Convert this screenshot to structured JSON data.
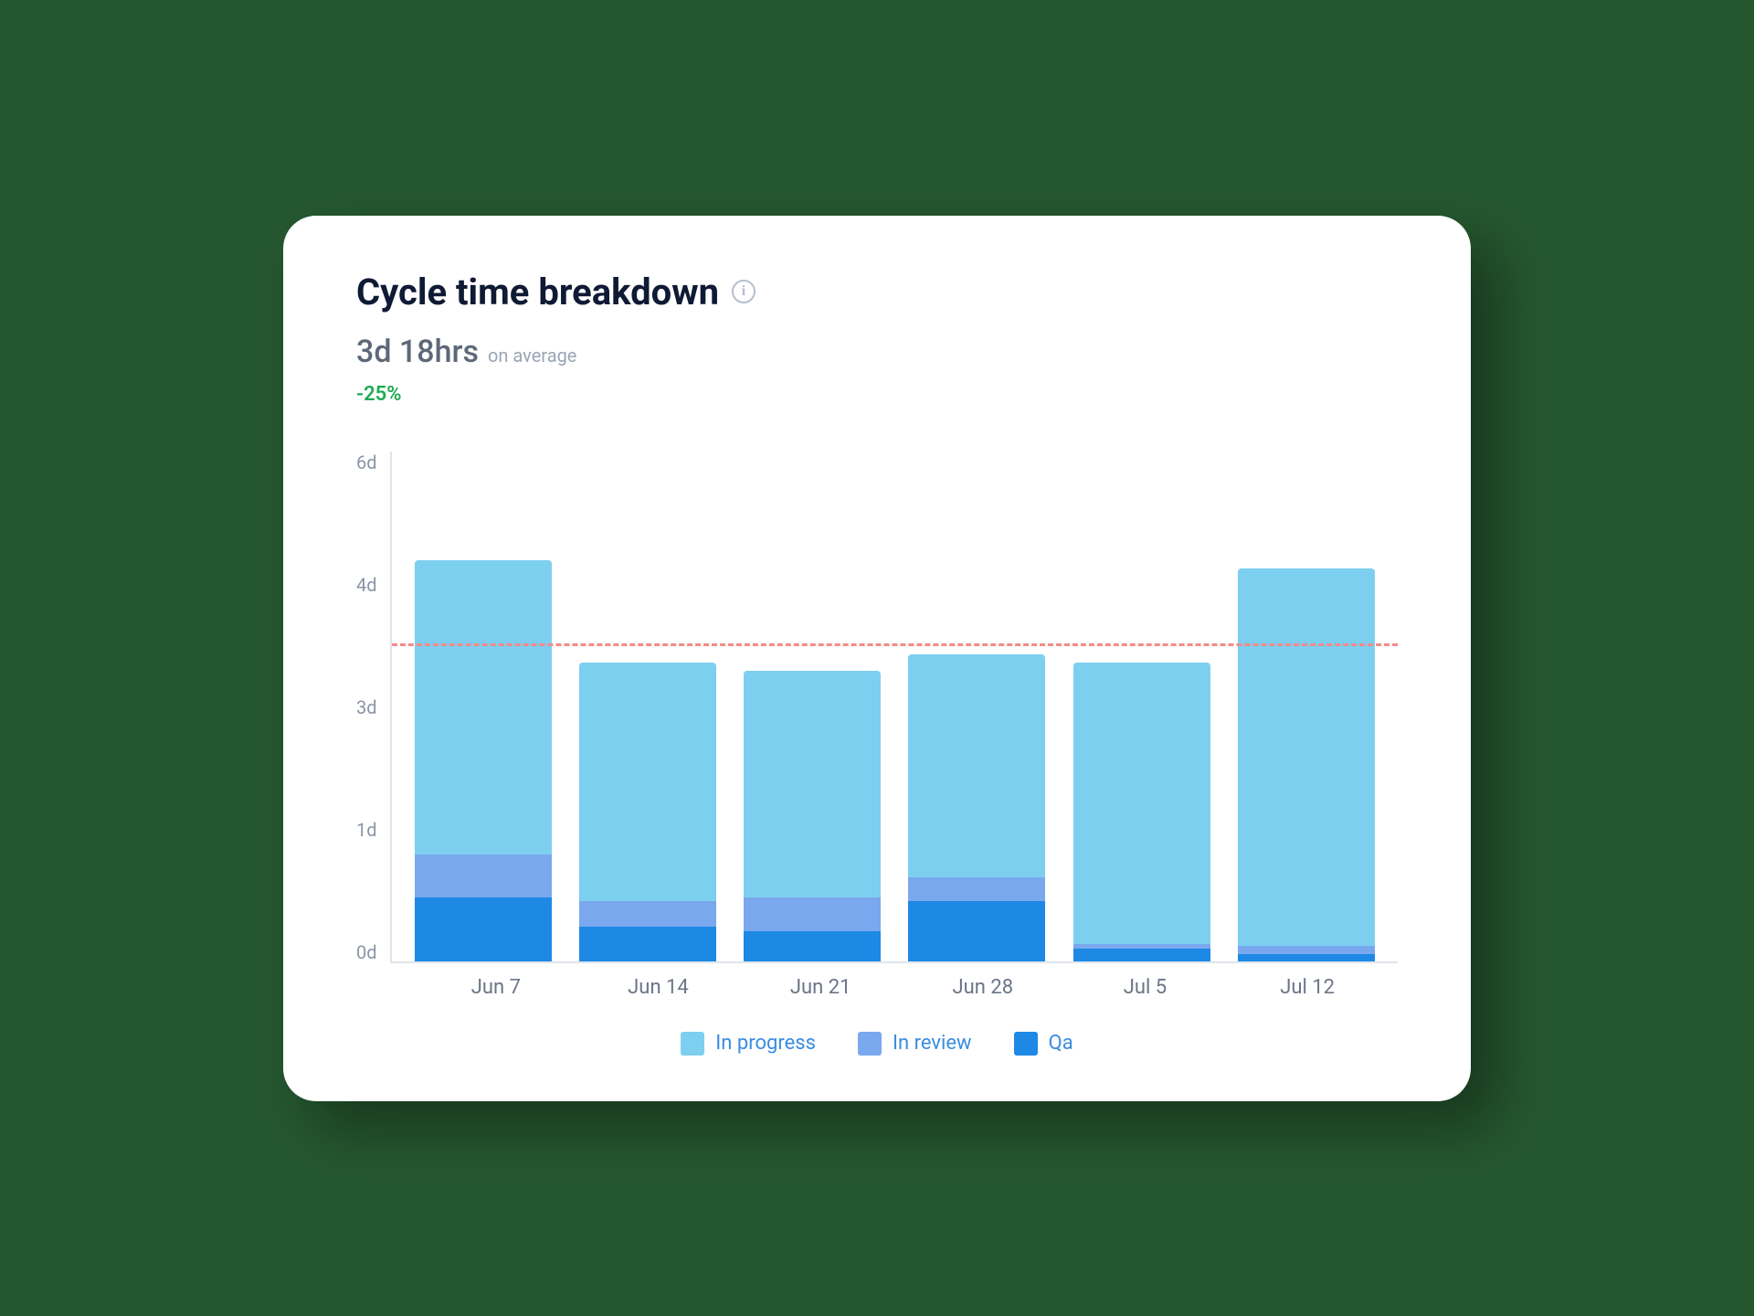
{
  "title": "Cycle time breakdown",
  "metric": {
    "value": "3d 18hrs",
    "suffix": "on average"
  },
  "delta": "-25%",
  "y_ticks": [
    "6d",
    "4d",
    "3d",
    "1d",
    "0d"
  ],
  "colors": {
    "in_progress": "#7dcff0",
    "in_review": "#7aa8ee",
    "qa": "#1e88e5",
    "avg_line": "#f38a8a",
    "delta": "#1fa951"
  },
  "legend": [
    {
      "key": "in_progress",
      "label": "In progress"
    },
    {
      "key": "in_review",
      "label": "In review"
    },
    {
      "key": "qa",
      "label": "Qa"
    }
  ],
  "chart_data": {
    "type": "bar",
    "stacked": true,
    "ylabel": "days",
    "ylim": [
      0,
      6
    ],
    "average_line": 3.75,
    "categories": [
      "Jun 7",
      "Jun 14",
      "Jun 21",
      "Jun 28",
      "Jul 5",
      "Jul 12"
    ],
    "series": [
      {
        "name": "Qa",
        "key": "qa",
        "values": [
          0.75,
          0.4,
          0.35,
          0.7,
          0.15,
          0.08
        ]
      },
      {
        "name": "In review",
        "key": "in_review",
        "values": [
          0.5,
          0.3,
          0.4,
          0.28,
          0.05,
          0.1
        ]
      },
      {
        "name": "In progress",
        "key": "in_progress",
        "values": [
          3.45,
          2.8,
          2.65,
          2.62,
          3.3,
          4.42
        ]
      }
    ]
  }
}
